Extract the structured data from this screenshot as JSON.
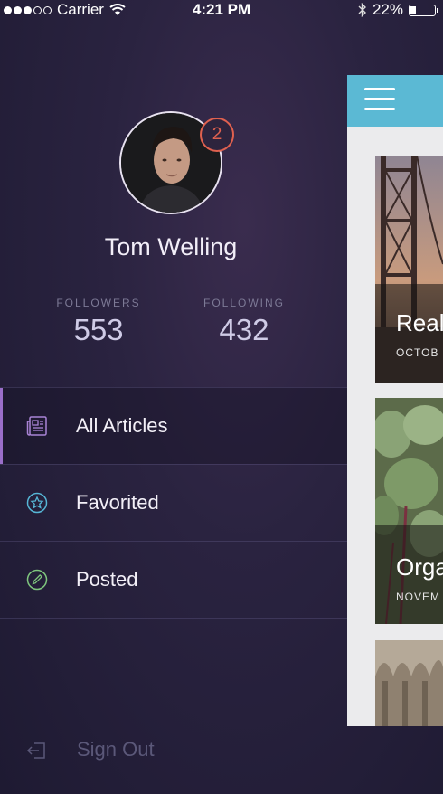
{
  "status_bar": {
    "carrier": "Carrier",
    "time": "4:21 PM",
    "battery": "22%",
    "signal_bars": 3,
    "battery_level": 0.22
  },
  "profile": {
    "name": "Tom Welling",
    "notification_count": "2",
    "followers_label": "FOLLOWERS",
    "followers_value": "553",
    "following_label": "FOLLOWING",
    "following_value": "432"
  },
  "menu": [
    {
      "label": "All Articles",
      "icon": "newspaper-icon",
      "active": true
    },
    {
      "label": "Favorited",
      "icon": "star-icon",
      "active": false
    },
    {
      "label": "Posted",
      "icon": "pencil-icon",
      "active": false
    }
  ],
  "sign_out": {
    "label": "Sign Out",
    "icon": "sign-out-icon"
  },
  "content": {
    "cards": [
      {
        "title": "Real",
        "date": "OCTOB"
      },
      {
        "title": "Orga",
        "date": "NOVEM"
      },
      {
        "title": "",
        "date": ""
      }
    ]
  },
  "colors": {
    "accent": "#5bb9d4",
    "badge": "#e0614f",
    "active_indicator": "#9a6ec9"
  }
}
